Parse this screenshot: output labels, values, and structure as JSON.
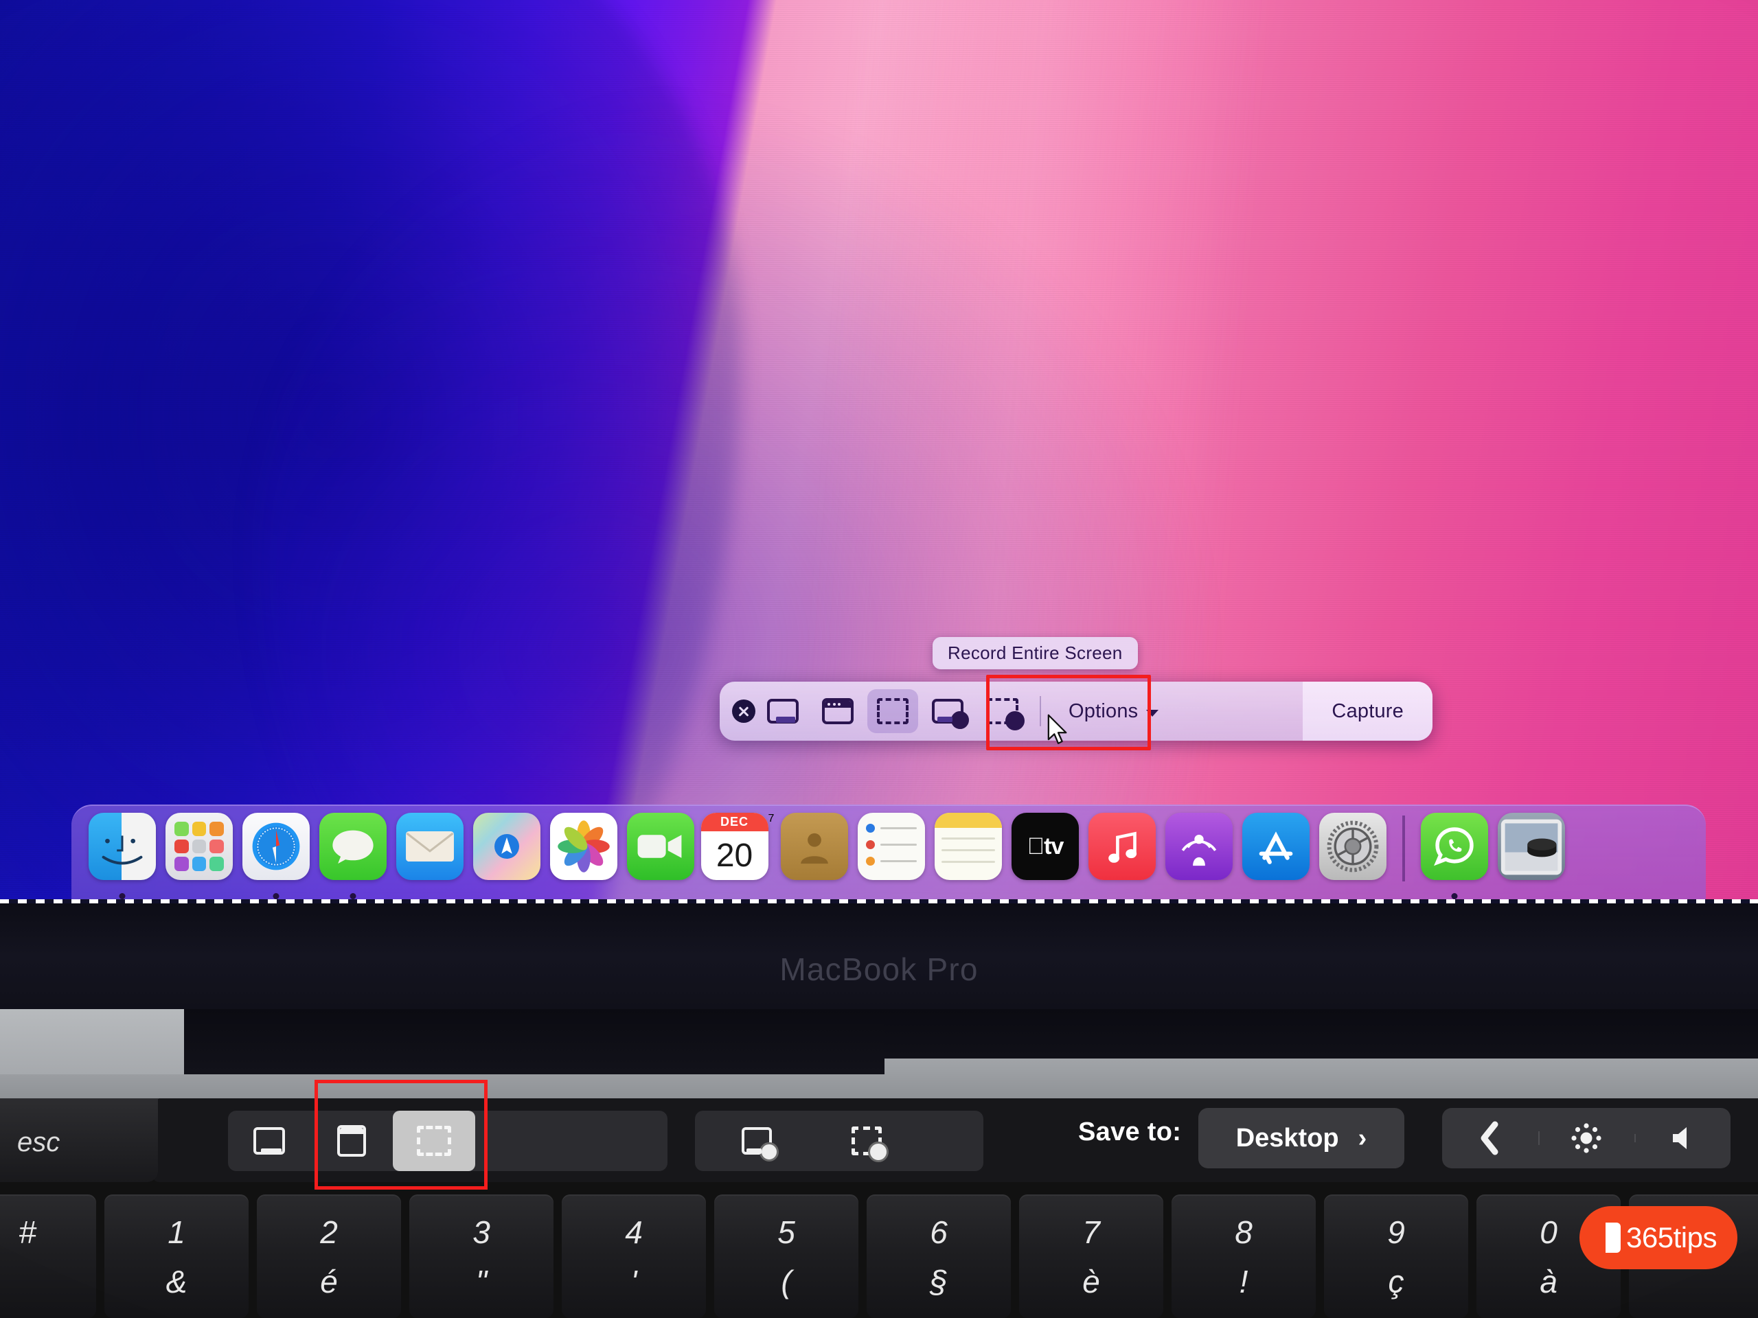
{
  "device": {
    "label": "MacBook Pro",
    "esc_key": "esc"
  },
  "screenshot_toolbar": {
    "tooltip": "Record Entire Screen",
    "close_label": "",
    "buttons": [
      {
        "name": "capture-entire-screen",
        "icon": "screen-icon",
        "selected": false
      },
      {
        "name": "capture-selected-window",
        "icon": "window-icon",
        "selected": false
      },
      {
        "name": "capture-selected-portion",
        "icon": "dashed-selection-icon",
        "selected": true
      },
      {
        "name": "record-entire-screen",
        "icon": "record-screen-icon",
        "selected": false
      },
      {
        "name": "record-selected-portion",
        "icon": "record-selection-icon",
        "selected": false
      }
    ],
    "options_label": "Options",
    "capture_label": "Capture"
  },
  "dock": {
    "items": [
      {
        "label": "Finder",
        "running": true
      },
      {
        "label": "Launchpad",
        "running": false
      },
      {
        "label": "Safari",
        "running": true
      },
      {
        "label": "Messages",
        "running": true
      },
      {
        "label": "Mail",
        "running": false
      },
      {
        "label": "Maps",
        "running": false
      },
      {
        "label": "Photos",
        "running": false
      },
      {
        "label": "FaceTime",
        "running": false
      },
      {
        "label": "Calendar",
        "running": false
      },
      {
        "label": "Contacts",
        "running": false
      },
      {
        "label": "Reminders",
        "running": false
      },
      {
        "label": "Notes",
        "running": false
      },
      {
        "label": "TV",
        "running": false
      },
      {
        "label": "Music",
        "running": false
      },
      {
        "label": "Podcasts",
        "running": false
      },
      {
        "label": "App Store",
        "running": false
      },
      {
        "label": "System Preferences",
        "running": false
      },
      {
        "label": "WhatsApp",
        "running": true
      },
      {
        "label": "Downloads",
        "running": false
      }
    ],
    "calendar": {
      "month": "DEC",
      "day": "20",
      "badge": "7"
    },
    "appletv_label": "tv"
  },
  "touchbar": {
    "buttons": [
      {
        "name": "capture-entire-screen",
        "icon": "screen-icon",
        "active": false
      },
      {
        "name": "capture-selected-window",
        "icon": "window-icon",
        "active": false
      },
      {
        "name": "capture-selected-portion",
        "icon": "dashed-selection-icon",
        "active": true
      },
      {
        "name": "record-entire-screen",
        "icon": "record-screen-icon",
        "active": false
      },
      {
        "name": "record-selected-portion",
        "icon": "record-selection-icon",
        "active": false
      }
    ],
    "save_to_label": "Save to:",
    "save_to_value": "Desktop",
    "save_to_chevron": "›",
    "controls": [
      "chevron-left-icon",
      "brightness-icon",
      "volume-icon"
    ]
  },
  "keyboard": {
    "layout": "AZERTY",
    "keys": [
      {
        "num": "1",
        "alt": "&"
      },
      {
        "num": "2",
        "alt": "é"
      },
      {
        "num": "3",
        "alt": "\""
      },
      {
        "num": "4",
        "alt": "'"
      },
      {
        "num": "5",
        "alt": "("
      },
      {
        "num": "6",
        "alt": "§"
      },
      {
        "num": "7",
        "alt": "è"
      },
      {
        "num": "8",
        "alt": "!"
      },
      {
        "num": "9",
        "alt": "ç"
      },
      {
        "num": "0",
        "alt": "à"
      }
    ]
  },
  "watermark": {
    "text": "365tips"
  },
  "annotations": {
    "highlight_color": "#f41d1d",
    "screen_box_label": "record-buttons-highlight",
    "touchbar_box_label": "touchbar-record-buttons-highlight"
  }
}
